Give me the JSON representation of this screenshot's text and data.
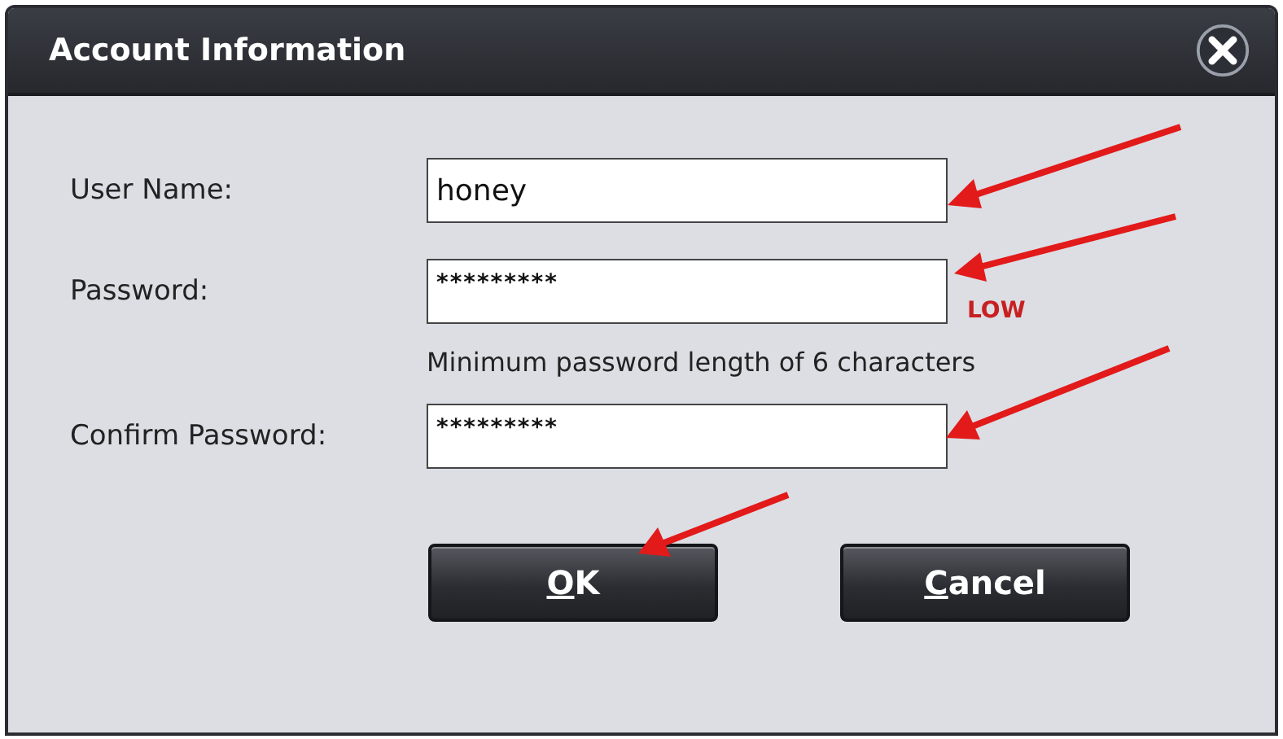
{
  "window": {
    "title": "Account Information"
  },
  "fields": [
    {
      "label": "User Name:",
      "value": "honey",
      "kind": "text"
    },
    {
      "label": "Password:",
      "value": "*********",
      "kind": "password",
      "strength": "LOW",
      "hint": "Minimum password length of 6 characters"
    },
    {
      "label": "Confirm Password:",
      "value": "*********",
      "kind": "password"
    }
  ],
  "buttons": [
    {
      "label": "OK"
    },
    {
      "label": "Cancel"
    }
  ]
}
